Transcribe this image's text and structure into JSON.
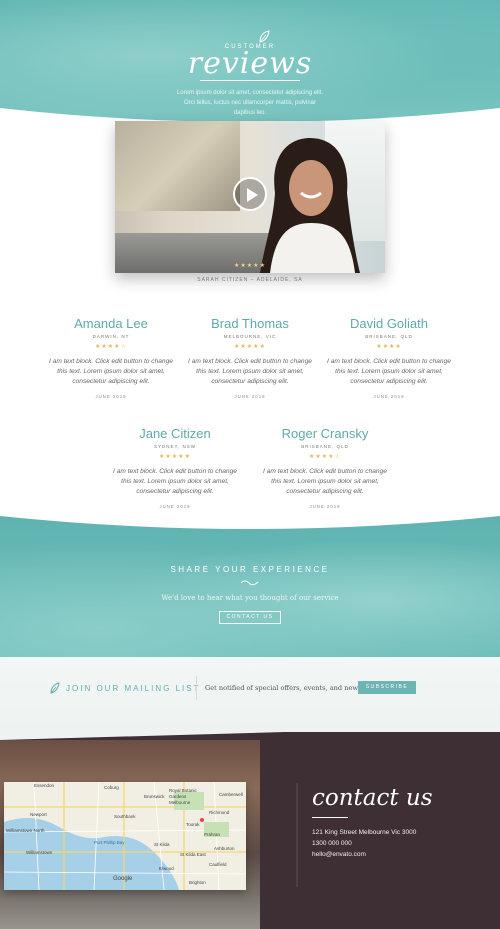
{
  "colors": {
    "teal": "#5fb5b2",
    "teal_text": "#5ea9ad",
    "star": "#e3b85a",
    "dark": "#3e2f35"
  },
  "hero": {
    "eyebrow": "CUSTOMER",
    "title": "reviews",
    "description": "Lorem ipsum dolor sit amet, consectetur adipiscing elit. Orci tellus, luctus nec ullamcorper mattis, pulvinar dapibus leo."
  },
  "video": {
    "stars": "★★★★★",
    "caption": "SARAH CITIZEN – ADELAIDE, SA",
    "play_icon": "play-icon"
  },
  "reviews": [
    {
      "name": "Amanda Lee",
      "location": "DARWIN, NT",
      "stars": "★★★★☆",
      "text": "I am text block. Click edit button to change this text. Lorem ipsum dolor sit amet, consectetur adipiscing elit.",
      "date": "JUNE 2019"
    },
    {
      "name": "Brad Thomas",
      "location": "MELBOURNE, VIC",
      "stars": "★★★★★",
      "text": "I am text block. Click edit button to change this text. Lorem ipsum dolor sit amet, consectetur adipiscing elit.",
      "date": "JUNE 2019"
    },
    {
      "name": "David Goliath",
      "location": "BRISBANE, QLD",
      "stars": "★★★★",
      "text": "I am text block. Click edit button to change this text. Lorem ipsum dolor sit amet, consectetur adipiscing elit.",
      "date": "JUNE 2019"
    },
    {
      "name": "Jane Citizen",
      "location": "SYDNEY, NSW",
      "stars": "★★★★★",
      "text": "I am text block. Click edit button to change this text. Lorem ipsum dolor sit amet, consectetur adipiscing elit.",
      "date": "JUNE 2019"
    },
    {
      "name": "Roger Cransky",
      "location": "BRISBANE, QLD",
      "stars": "★★★★☆",
      "text": "I am text block. Click edit button to change this text. Lorem ipsum dolor sit amet, consectetur adipiscing elit.",
      "date": "JUNE 2019"
    }
  ],
  "share": {
    "title": "SHARE YOUR EXPERIENCE",
    "text": "We'd love to hear what you thought of our service",
    "button": "CONTACT US"
  },
  "mailing": {
    "title": "JOIN OUR MAILING LIST",
    "text": "Get notified of special offers, events, and news",
    "button": "SUBSCRIBE"
  },
  "contact": {
    "title": "contact us",
    "address": "121 King Street Melbourne Vic 3000",
    "phone": "1300 000 000",
    "email": "hello@envato.com",
    "map_labels": [
      "Essendon",
      "Coburg",
      "Brunswick",
      "Newport",
      "Williamstown North",
      "Williamstown",
      "Southbank",
      "Port Phillip Bay",
      "Royal Botanic Gardens Melbourne",
      "Richmond",
      "Prahran",
      "St Kilda",
      "Elwood",
      "Brighton",
      "Caulfield",
      "Camberwell",
      "Ashburton",
      "Toorak",
      "St Kilda East"
    ],
    "map_brand": "Google"
  }
}
